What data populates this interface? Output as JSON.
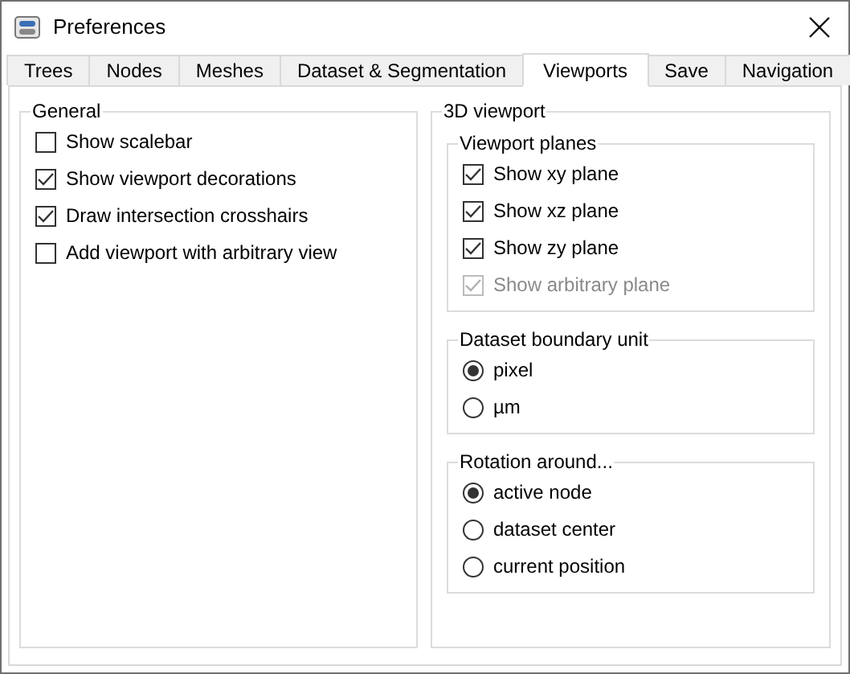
{
  "window": {
    "title": "Preferences"
  },
  "tabs": [
    {
      "label": "Trees",
      "selected": false
    },
    {
      "label": "Nodes",
      "selected": false
    },
    {
      "label": "Meshes",
      "selected": false
    },
    {
      "label": "Dataset & Segmentation",
      "selected": false
    },
    {
      "label": "Viewports",
      "selected": true
    },
    {
      "label": "Save",
      "selected": false
    },
    {
      "label": "Navigation",
      "selected": false
    }
  ],
  "general": {
    "title": "General",
    "options": [
      {
        "label": "Show scalebar",
        "checked": false
      },
      {
        "label": "Show viewport decorations",
        "checked": true
      },
      {
        "label": "Draw intersection crosshairs",
        "checked": true
      },
      {
        "label": "Add viewport with arbitrary view",
        "checked": false
      }
    ]
  },
  "viewport_3d": {
    "title": "3D viewport",
    "groups": [
      {
        "title": "Viewport planes",
        "kind": "checks",
        "items": [
          {
            "label": "Show xy plane",
            "checked": true,
            "disabled": false
          },
          {
            "label": "Show xz plane",
            "checked": true,
            "disabled": false
          },
          {
            "label": "Show zy plane",
            "checked": true,
            "disabled": false
          },
          {
            "label": "Show arbitrary plane",
            "checked": true,
            "disabled": true
          }
        ]
      },
      {
        "title": "Dataset boundary unit",
        "kind": "radios",
        "items": [
          {
            "label": "pixel",
            "selected": true
          },
          {
            "label": "µm",
            "selected": false
          }
        ]
      },
      {
        "title": "Rotation around...",
        "kind": "radios",
        "items": [
          {
            "label": "active node",
            "selected": true
          },
          {
            "label": "dataset center",
            "selected": false
          },
          {
            "label": "current position",
            "selected": false
          }
        ]
      }
    ]
  }
}
